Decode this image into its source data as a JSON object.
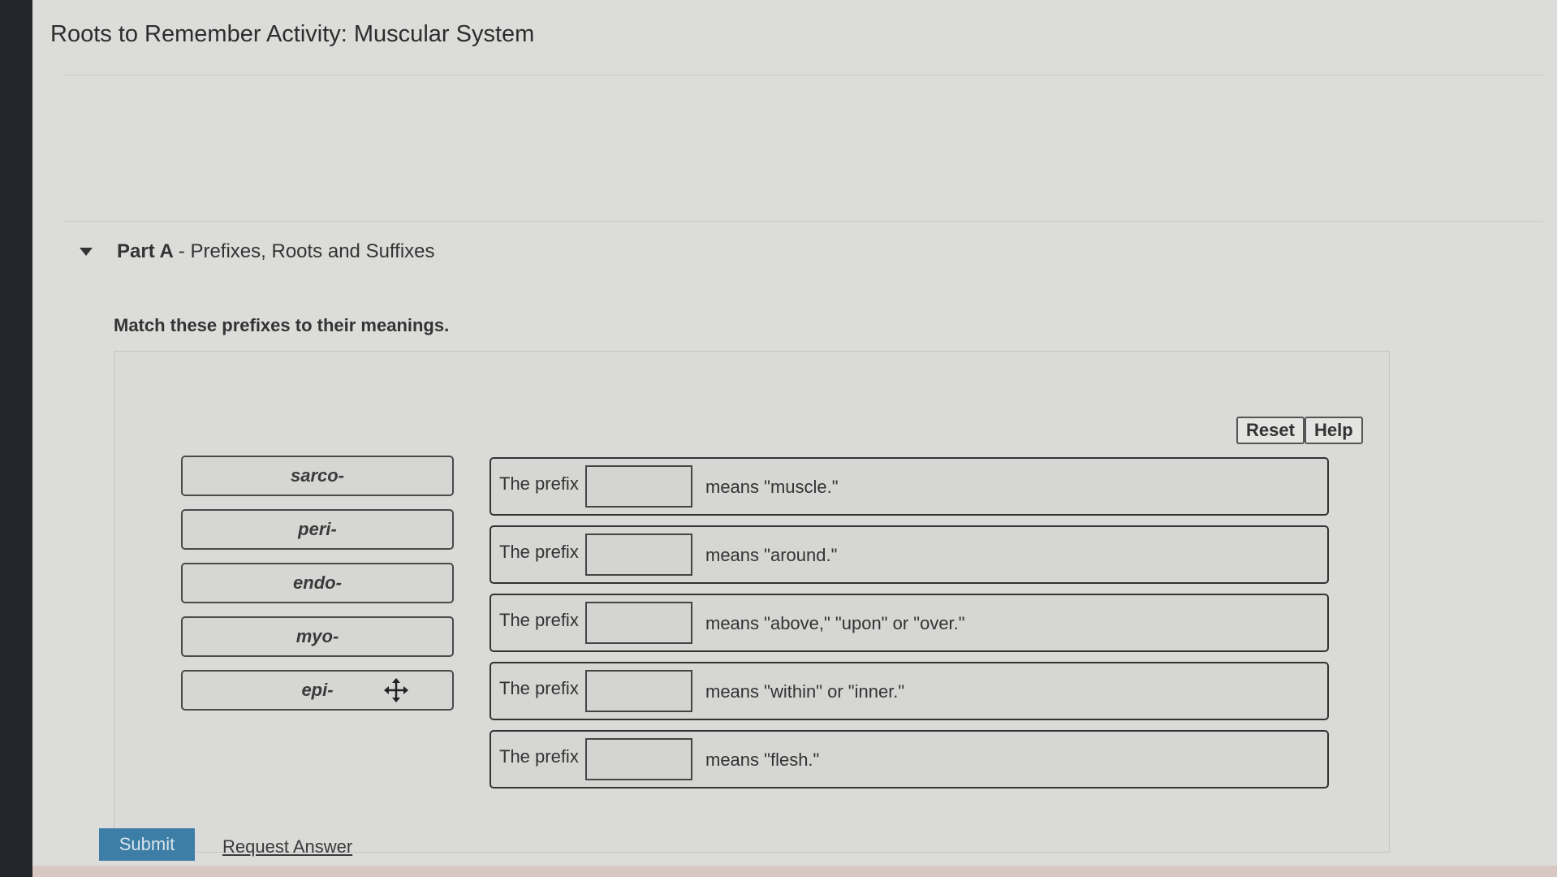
{
  "page": {
    "title": "Roots to Remember Activity: Muscular System"
  },
  "part": {
    "label_bold": "Part A",
    "label_rest": "- Prefixes, Roots and Suffixes"
  },
  "instructions": "Match these prefixes to their meanings.",
  "buttons": {
    "reset": "Reset",
    "help": "Help",
    "submit": "Submit",
    "request_answer": "Request Answer"
  },
  "labels": [
    "sarco-",
    "peri-",
    "endo-",
    "myo-",
    "epi-"
  ],
  "targets": [
    {
      "prefix_text": "The prefix",
      "meaning": "means \"muscle.\""
    },
    {
      "prefix_text": "The prefix",
      "meaning": "means \"around.\""
    },
    {
      "prefix_text": "The prefix",
      "meaning": "means \"above,\" \"upon\" or \"over.\""
    },
    {
      "prefix_text": "The prefix",
      "meaning": "means \"within\" or \"inner.\""
    },
    {
      "prefix_text": "The prefix",
      "meaning": "means \"flesh.\""
    }
  ],
  "colors": {
    "submit_bg": "#3d7ea6",
    "page_bg": "#dcdcda"
  },
  "icons": {
    "move_cursor": "move-icon",
    "collapse": "caret-down-icon"
  }
}
